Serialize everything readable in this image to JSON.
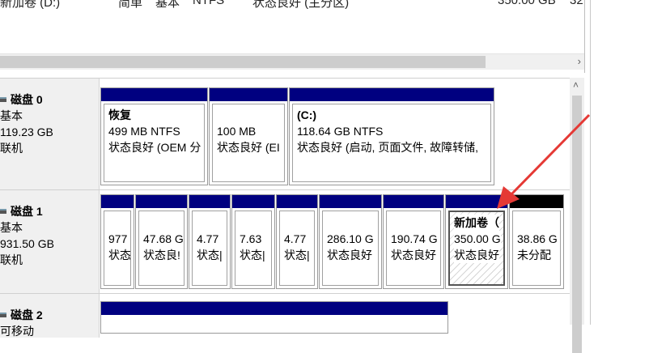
{
  "top_row": {
    "name": "新加卷 (D:)",
    "layout": "简单",
    "type": "基本",
    "fs": "NTFS",
    "status": "状态良好 (主分区)",
    "capacity": "350.00 GB",
    "free": "32"
  },
  "disks": [
    {
      "name": "磁盘 0",
      "type": "基本",
      "size": "119.23 GB",
      "state": "联机",
      "partitions": [
        {
          "title": "恢复",
          "line1": "499 MB NTFS",
          "line2": "状态良好 (OEM 分"
        },
        {
          "title": "",
          "line1": "100 MB",
          "line2": "状态良好 (EI"
        },
        {
          "title": "(C:)",
          "line1": "118.64 GB NTFS",
          "line2": "状态良好 (启动, 页面文件, 故障转储,"
        }
      ]
    },
    {
      "name": "磁盘 1",
      "type": "基本",
      "size": "931.50 GB",
      "state": "联机",
      "partitions": [
        {
          "title": "",
          "line1": "977",
          "line2": "状态"
        },
        {
          "title": "",
          "line1": "47.68 G",
          "line2": "状态良!"
        },
        {
          "title": "",
          "line1": "4.77",
          "line2": "状态|"
        },
        {
          "title": "",
          "line1": "7.63",
          "line2": "状态|"
        },
        {
          "title": "",
          "line1": "4.77",
          "line2": "状态|"
        },
        {
          "title": "",
          "line1": "286.10 G",
          "line2": "状态良好"
        },
        {
          "title": "",
          "line1": "190.74 G",
          "line2": "状态良好"
        },
        {
          "title": "新加卷（",
          "line1": "350.00 G",
          "line2": "状态良好"
        },
        {
          "title": "",
          "line1": "38.86 G",
          "line2": "未分配"
        }
      ]
    },
    {
      "name": "磁盘 2",
      "type": "可移动"
    }
  ],
  "colors": {
    "primary_bar": "#000080",
    "unallocated_bar": "#000000",
    "annotation_arrow": "#e53935"
  }
}
